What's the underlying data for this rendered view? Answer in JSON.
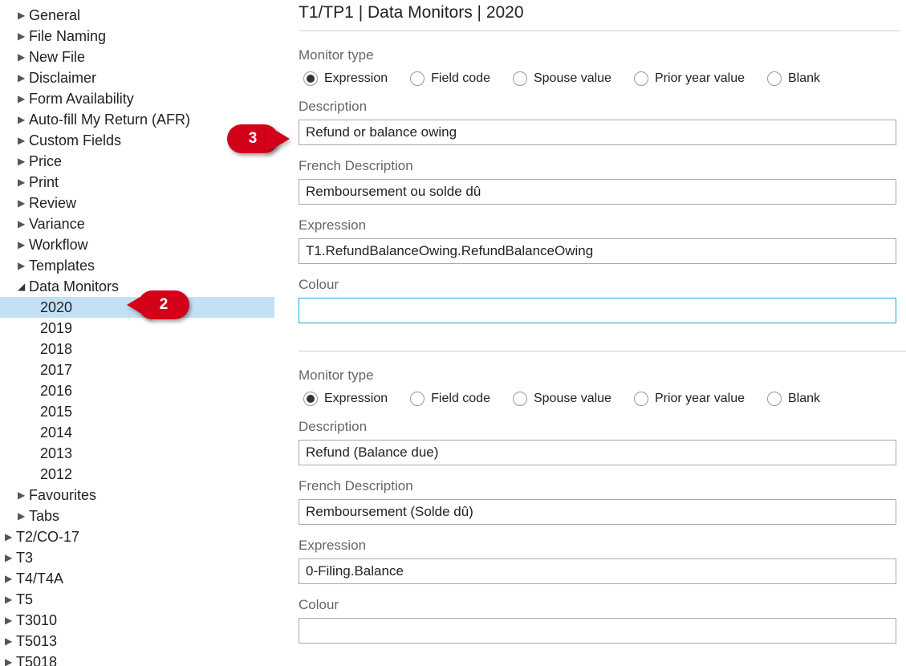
{
  "header": {
    "title": "T1/TP1 | Data Monitors | 2020"
  },
  "tree": {
    "l1_items": [
      "General",
      "File Naming",
      "New File",
      "Disclaimer",
      "Form Availability",
      "Auto-fill My Return (AFR)",
      "Custom Fields",
      "Price",
      "Print",
      "Review",
      "Variance",
      "Workflow",
      "Templates"
    ],
    "data_monitors_label": "Data Monitors",
    "years": [
      "2020",
      "2019",
      "2018",
      "2017",
      "2016",
      "2015",
      "2014",
      "2013",
      "2012"
    ],
    "selected_year": "2020",
    "after_monitors": [
      "Favourites",
      "Tabs"
    ],
    "l0_items": [
      "T2/CO-17",
      "T3",
      "T4/T4A",
      "T5",
      "T3010",
      "T5013",
      "T5018"
    ]
  },
  "radio_options": {
    "label": "Monitor type",
    "opts": [
      "Expression",
      "Field code",
      "Spouse value",
      "Prior year value",
      "Blank"
    ],
    "selected": "Expression"
  },
  "labels": {
    "description": "Description",
    "french_description": "French Description",
    "expression": "Expression",
    "colour": "Colour"
  },
  "monitors": [
    {
      "description": "Refund or balance owing",
      "french_description": "Remboursement ou solde dû",
      "expression": "T1.RefundBalanceOwing.RefundBalanceOwing",
      "colour": ""
    },
    {
      "description": "Refund (Balance due)",
      "french_description": "Remboursement (Solde dû)",
      "expression": "0-Filing.Balance",
      "colour": ""
    }
  ],
  "callouts": {
    "two": "2",
    "three": "3"
  }
}
